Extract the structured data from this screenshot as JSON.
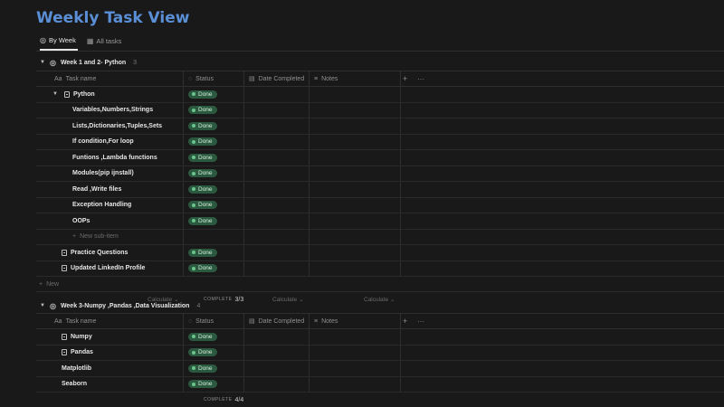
{
  "page": {
    "title": "Weekly Task View"
  },
  "tabs": [
    {
      "label": "By Week",
      "icon": "target-icon",
      "active": true
    },
    {
      "label": "All tasks",
      "icon": "table-icon",
      "active": false
    }
  ],
  "columns": {
    "name": "Task name",
    "status": "Status",
    "date": "Date Completed",
    "notes": "Notes"
  },
  "groups": [
    {
      "title": "Week 1 and 2- Python",
      "count": "3",
      "rows": [
        {
          "name": "Python",
          "status": "Done",
          "level": 0,
          "expanded": true,
          "icon": "document-icon"
        },
        {
          "name": "Variables,Numbers,Strings",
          "status": "Done",
          "level": 1
        },
        {
          "name": "Lists,Dictionaries,Tuples,Sets",
          "status": "Done",
          "level": 1
        },
        {
          "name": "If condition,For loop",
          "status": "Done",
          "level": 1
        },
        {
          "name": "Funtions ,Lambda functions",
          "status": "Done",
          "level": 1
        },
        {
          "name": "Modules(pip ijnstall)",
          "status": "Done",
          "level": 1
        },
        {
          "name": "Read ,Write files",
          "status": "Done",
          "level": 1
        },
        {
          "name": "Exception Handling",
          "status": "Done",
          "level": 1
        },
        {
          "name": "OOPs",
          "status": "Done",
          "level": 1
        },
        {
          "new_sub": "New sub-item"
        },
        {
          "name": "Practice Questions",
          "status": "Done",
          "level": 0,
          "icon": "document-icon"
        },
        {
          "name": "Updated LinkedIn Profile",
          "status": "Done",
          "level": 0,
          "icon": "document-icon"
        }
      ],
      "new_label": "New",
      "calc_label": "Calculate",
      "complete_label": "COMPLETE",
      "complete_value": "3/3"
    },
    {
      "title": "Week 3-Numpy ,Pandas ,Data Visualization",
      "count": "4",
      "rows": [
        {
          "name": "Numpy",
          "status": "Done",
          "level": 0,
          "icon": "document-icon"
        },
        {
          "name": "Pandas",
          "status": "Done",
          "level": 0,
          "icon": "document-icon"
        },
        {
          "name": "Matplotlib",
          "status": "Done",
          "level": 0
        },
        {
          "name": "Seaborn",
          "status": "Done",
          "level": 0
        }
      ],
      "complete_label": "COMPLETE",
      "complete_value": "4/4"
    }
  ]
}
